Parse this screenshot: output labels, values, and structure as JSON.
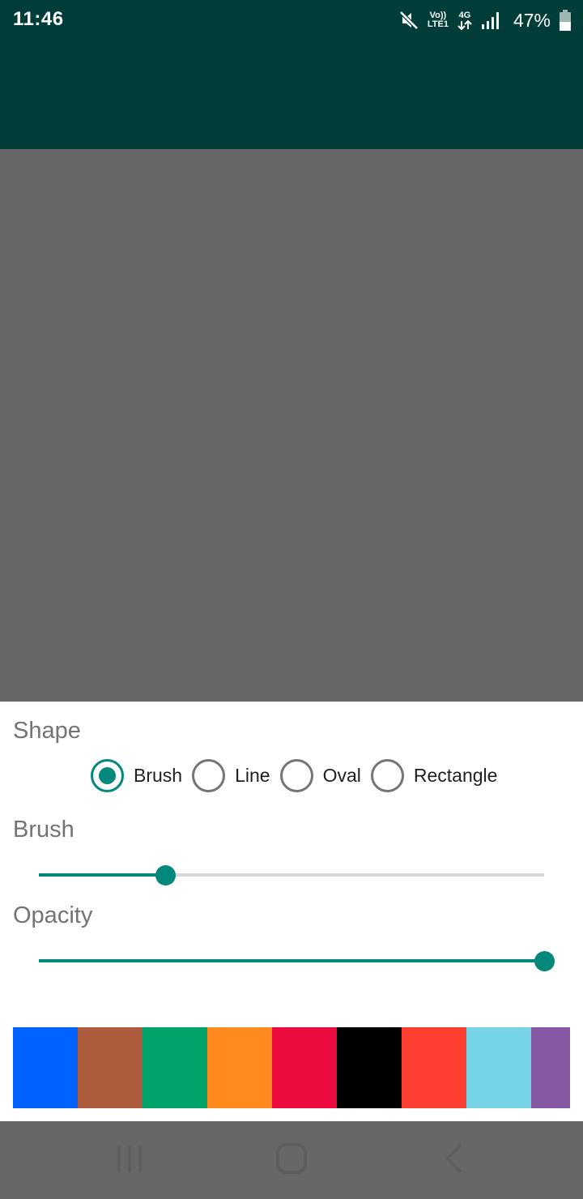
{
  "status_bar": {
    "time": "11:46",
    "volte_label_top": "Vo))",
    "volte_label_bottom": "LTE1",
    "network_label": "4G",
    "battery_percent": "47%",
    "icons": [
      "mute-icon",
      "volte-icon",
      "data-arrows-icon",
      "signal-icon",
      "battery-icon"
    ],
    "battery_level": 0.47
  },
  "app_bar": {
    "color": "#003d38"
  },
  "canvas": {
    "color": "#676767"
  },
  "sheet": {
    "shape_title": "Shape",
    "shape_options": [
      {
        "label": "Brush",
        "checked": true
      },
      {
        "label": "Line",
        "checked": false
      },
      {
        "label": "Oval",
        "checked": false
      },
      {
        "label": "Rectangle",
        "checked": false
      }
    ],
    "brush_title": "Brush",
    "brush_value": 0.25,
    "opacity_title": "Opacity",
    "opacity_value": 1.0,
    "accent_color": "#00897b",
    "palette": [
      "#0062ff",
      "#ad5c3e",
      "#00a36a",
      "#ff8a1e",
      "#ed0b3f",
      "#000000",
      "#ff3f32",
      "#77d4e6",
      "#8759a4"
    ]
  },
  "nav_bar": {
    "icons": [
      "recents-icon",
      "home-icon",
      "back-icon"
    ]
  }
}
